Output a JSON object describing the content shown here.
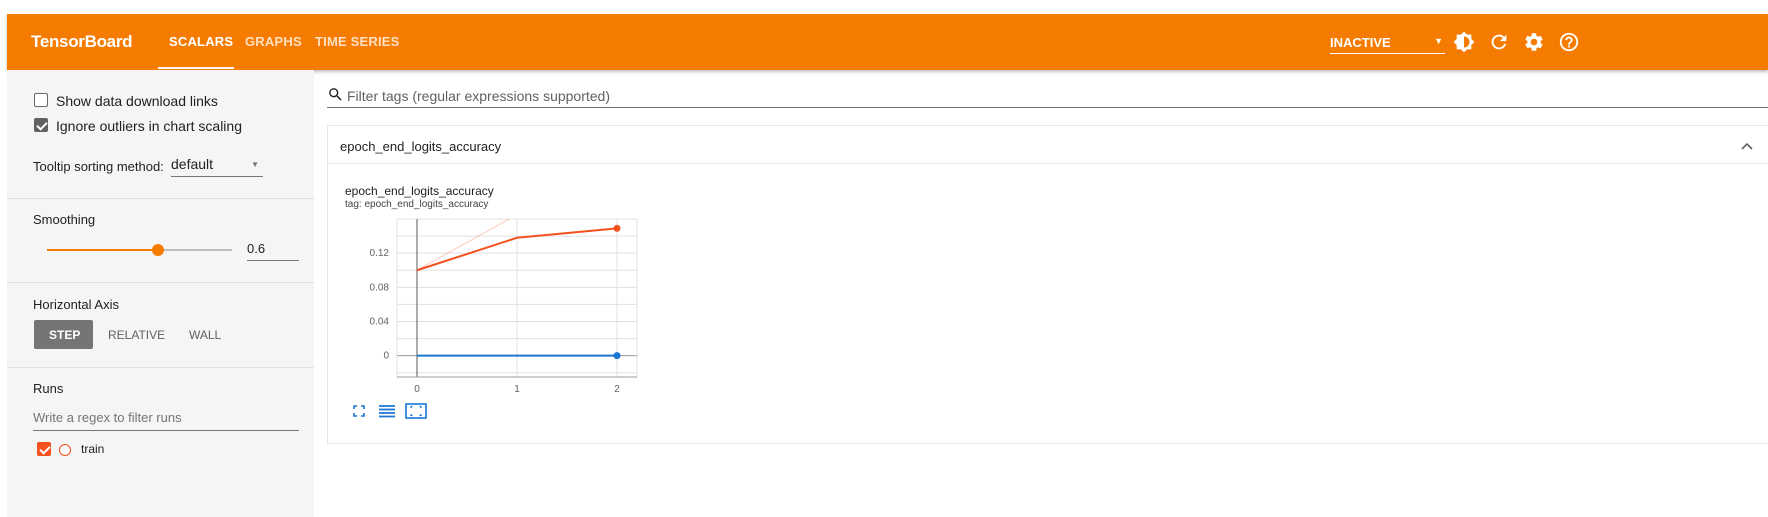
{
  "app": {
    "brand": "TensorBoard",
    "accent": "#f57c00"
  },
  "tabs": [
    {
      "label": "SCALARS",
      "active": true
    },
    {
      "label": "GRAPHS",
      "active": false
    },
    {
      "label": "TIME SERIES",
      "active": false
    }
  ],
  "header": {
    "run_status": "INACTIVE",
    "icons": [
      "brightness-icon",
      "refresh-icon",
      "settings-icon",
      "help-icon"
    ]
  },
  "sidebar": {
    "show_download_links": {
      "label": "Show data download links",
      "checked": false
    },
    "ignore_outliers": {
      "label": "Ignore outliers in chart scaling",
      "checked": true
    },
    "tooltip_sorting": {
      "label": "Tooltip sorting method:",
      "value": "default"
    },
    "smoothing": {
      "label": "Smoothing",
      "value": "0.6",
      "fraction": 0.6
    },
    "horizontal_axis": {
      "label": "Horizontal Axis",
      "options": [
        "STEP",
        "RELATIVE",
        "WALL"
      ],
      "selected": "STEP"
    },
    "runs": {
      "label": "Runs",
      "filter_placeholder": "Write a regex to filter runs",
      "items": [
        {
          "name": "train",
          "checked": true,
          "color": "#f4511e"
        }
      ]
    }
  },
  "main": {
    "filter_placeholder": "Filter tags (regular expressions supported)",
    "group_title": "epoch_end_logits_accuracy",
    "card": {
      "title": "epoch_end_logits_accuracy",
      "tag": "tag: epoch_end_logits_accuracy",
      "buttons": [
        "fullscreen-icon",
        "data-table-icon",
        "fit-domain-icon"
      ]
    }
  },
  "chart_data": {
    "type": "line",
    "title": "epoch_end_logits_accuracy",
    "x": [
      0,
      1,
      2
    ],
    "x_ticks": [
      "0",
      "1",
      "2"
    ],
    "y_ticks": [
      "0",
      "0.04",
      "0.08",
      "0.12"
    ],
    "xlim": [
      -0.2,
      2.2
    ],
    "ylim": [
      -0.025,
      0.16
    ],
    "grid": true,
    "series": [
      {
        "smoothed": [
          0.1,
          0.138,
          0.149
        ],
        "raw": [
          0.1,
          0.165,
          0.2
        ],
        "color": "#f4511e"
      },
      {
        "smoothed": [
          0,
          0,
          0
        ],
        "color": "#1976d2"
      }
    ]
  }
}
